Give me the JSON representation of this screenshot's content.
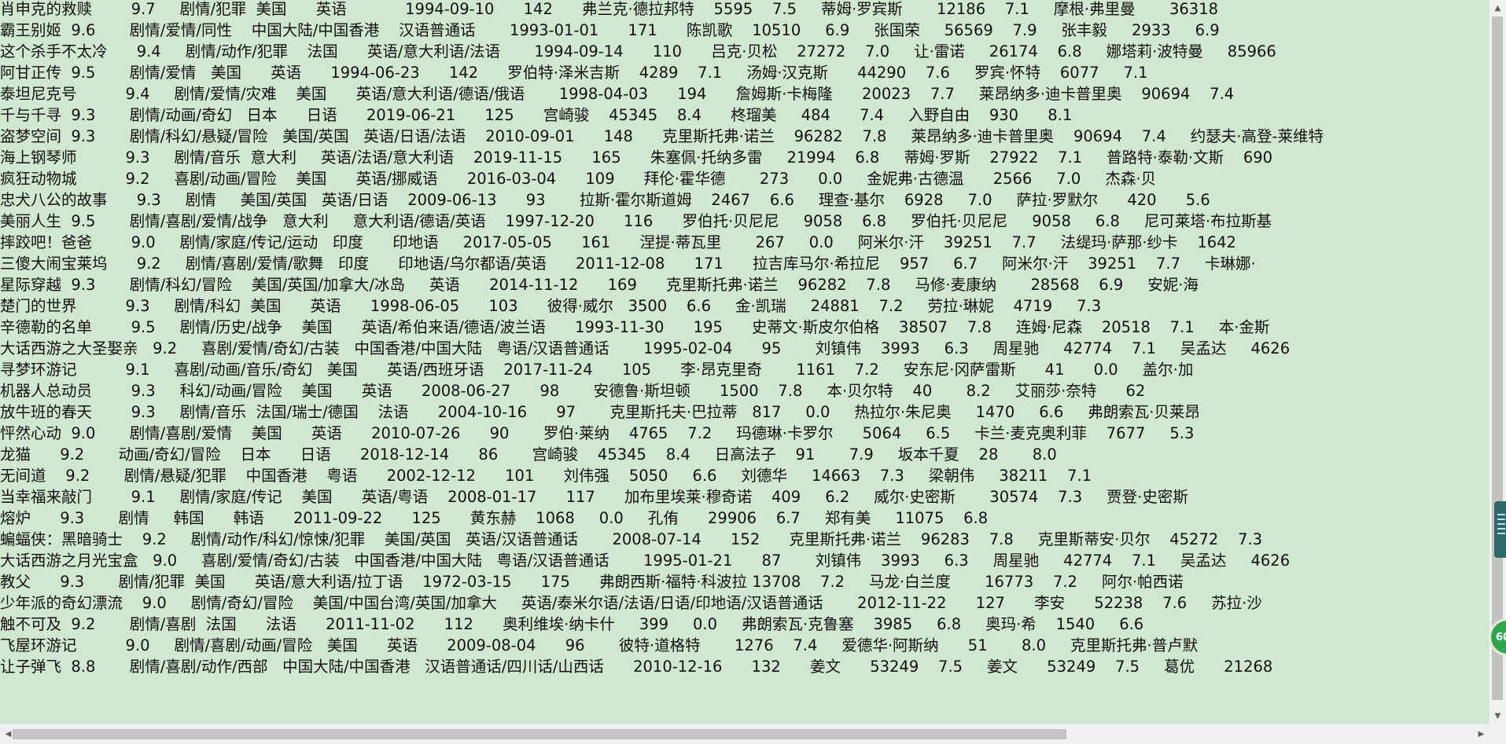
{
  "lines": [
    "肖申克的救赎        9.7     剧情/犯罪  美国      英语            1994-09-10      142      弗兰克·德拉邦特    5595    7.5     蒂姆·罗宾斯       12186    7.1     摩根·弗里曼       36318",
    "霸王别姬  9.6       剧情/爱情/同性    中国大陆/中国香港    汉语普通话       1993-01-01      171      陈凯歌    10510     6.9     张国荣     56569    7.9     张丰毅     2933     6.9",
    "这个杀手不太冷      9.4     剧情/动作/犯罪    法国      英语/意大利语/法语       1994-09-14      110      吕克·贝松    27272    7.0     让·雷诺     26174    6.8     娜塔莉·波特曼     85966",
    "阿甘正传  9.5       剧情/爱情   美国      英语      1994-06-23      142      罗伯特·泽米吉斯    4289    7.1     汤姆·汉克斯      44290    7.6     罗宾·怀特    6077     7.1",
    "泰坦尼克号          9.4     剧情/爱情/灾难    美国      英语/意大利语/德语/俄语       1998-04-03      194      詹姆斯·卡梅隆      20023    7.7     莱昂纳多·迪卡普里奥    90694    7.4",
    "千与千寻  9.3       剧情/动画/奇幻   日本      日语      2019-06-21      125      宫崎骏    45345    8.4      柊瑠美     484      7.4     入野自由    930      8.1",
    "盗梦空间  9.3       剧情/科幻/悬疑/冒险   美国/英国   英语/日语/法语    2010-09-01      148      克里斯托弗·诺兰    96282    7.8     莱昂纳多·迪卡普里奥    90694    7.4     约瑟夫·高登-莱维特",
    "海上钢琴师          9.3     剧情/音乐  意大利     英语/法语/意大利语    2019-11-15      165      朱塞佩·托纳多雷     21994    6.8     蒂姆·罗斯    27922    7.1     普路特·泰勒·文斯    690",
    "疯狂动物城          9.2     喜剧/动画/冒险    美国      英语/挪威语      2016-03-04      109      拜伦·霍华德       273      0.0     金妮弗·古德温      2566     7.0     杰森·贝",
    "忠犬八公的故事      9.3     剧情     美国/英国   英语/日语    2009-06-13      93       拉斯·霍尔斯道姆    2467    6.6     理查·基尔    6928     7.0     萨拉·罗默尔      420      5.6",
    "美丽人生  9.5       剧情/喜剧/爱情/战争   意大利     意大利语/德语/英语    1997-12-20      116      罗伯托·贝尼尼     9058    6.8     罗伯托·贝尼尼     9058     6.8     尼可莱塔·布拉斯基",
    "摔跤吧！爸爸        9.0     剧情/家庭/传记/运动   印度      印地语     2017-05-05      161      涅提·蒂瓦里       267     0.0     阿米尔·汗    39251    7.7     法缇玛·萨那·纱卡    1642",
    "三傻大闹宝莱坞      9.2     剧情/喜剧/爱情/歌舞   印度      印地语/乌尔都语/英语      2011-12-08      171      拉吉库马尔·希拉尼    957     6.7     阿米尔·汗    39251    7.7     卡琳娜·",
    "星际穿越  9.3       剧情/科幻/冒险    美国/英国/加拿大/冰岛     英语      2014-11-12      169      克里斯托弗·诺兰    96282    7.8     马修·麦康纳       28568    6.9     安妮·海",
    "楚门的世界          9.3     剧情/科幻  美国      英语      1998-06-05      103      彼得·威尔   3500    6.6     金·凯瑞     24881    7.2     劳拉·琳妮    4719     7.3",
    "辛德勒的名单        9.5     剧情/历史/战争    美国      英语/希伯来语/德语/波兰语      1993-11-30      195      史蒂文·斯皮尔伯格    38507    7.8     连姆·尼森    20518    7.1     本·金斯",
    "大话西游之大圣娶亲   9.2     喜剧/爱情/奇幻/古装   中国香港/中国大陆   粤语/汉语普通话       1995-02-04      95       刘镇伟    3993     6.3     周星驰     42774    7.1     吴孟达     4626",
    "寻梦环游记          9.1     喜剧/动画/音乐/奇幻   美国      英语/西班牙语    2017-11-24      105      李·昂克里奇       1161    7.2     安东尼·冈萨雷斯      41      0.0     盖尔·加",
    "机器人总动员        9.3     科幻/动画/冒险    美国      英语      2008-06-27      98       安德鲁·斯坦顿      1500    7.8     本·贝尔特    40       8.2     艾丽莎·奈特      62",
    "放牛班的春天        9.3     剧情/音乐  法国/瑞士/德国    法语      2004-10-16      97       克里斯托夫·巴拉蒂   817     0.0     热拉尔·朱尼奥     1470     6.6     弗朗索瓦·贝莱昂",
    "怦然心动  9.0       剧情/喜剧/爱情    美国      英语      2010-07-26      90       罗伯·莱纳    4765    7.2     玛德琳·卡罗尔      5064     6.5     卡兰·麦克奥利菲    7677     5.3",
    "龙猫      9.2       动画/奇幻/冒险    日本      日语      2018-12-14      86       宫崎骏    45345    8.4     日高法子    91       7.9     坂本千夏    28       8.0",
    "无间道    9.2       剧情/悬疑/犯罪    中国香港    粤语      2002-12-12      101      刘伟强    5050     6.6     刘德华     14663    7.3     梁朝伟     38211    7.1",
    "当幸福来敲门        9.1     剧情/家庭/传记    美国      英语/粤语    2008-01-17      117      加布里埃莱·穆奇诺    409     6.2     威尔·史密斯       30574    7.3     贾登·史密斯",
    "熔炉      9.3       剧情     韩国      韩语      2011-09-22      125      黄东赫    1068     0.0     孔侑      29906    6.7     郑有美     11075    6.8",
    "蝙蝠侠：黑暗骑士    9.2     剧情/动作/科幻/惊悚/犯罪    美国/英国   英语/汉语普通话       2008-07-14      152      克里斯托弗·诺兰    96283    7.8     克里斯蒂安·贝尔    45272    7.3",
    "大话西游之月光宝盒   9.0     喜剧/爱情/奇幻/古装   中国香港/中国大陆   粤语/汉语普通话       1995-01-21      87       刘镇伟    3993     6.3     周星驰     42774    7.1     吴孟达     4626",
    "教父      9.3       剧情/犯罪  美国      英语/意大利语/拉丁语    1972-03-15      175      弗朗西斯·福特·科波拉 13708    7.2     马龙·白兰度       16773    7.2     阿尔·帕西诺",
    "少年派的奇幻漂流    9.0     剧情/奇幻/冒险    美国/中国台湾/英国/加拿大     英语/泰米尔语/法语/日语/印地语/汉语普通话       2012-11-22      127      李安      52238    7.6     苏拉·沙",
    "触不可及  9.2       剧情/喜剧  法国      法语      2011-11-02      112      奥利维埃·纳卡什     399     0.0     弗朗索瓦·克鲁塞    3985     6.8     奥玛·希    1540     6.6",
    "飞屋环游记          9.0     剧情/喜剧/动画/冒险   美国      英语      2009-08-04      96       彼特·道格特       1276    7.4     爱德华·阿斯纳      51       8.0     克里斯托弗·普卢默",
    "让子弹飞  8.8       剧情/喜剧/动作/西部   中国大陆/中国香港   汉语普通话/四川话/山西话      2010-12-16      132      姜文      53249    7.5     姜文      53249    7.5     葛优      21268"
  ],
  "badge_text": "60",
  "scroll_arrows": {
    "up": "▲",
    "down": "▼",
    "left": "◀",
    "right": "▶"
  }
}
